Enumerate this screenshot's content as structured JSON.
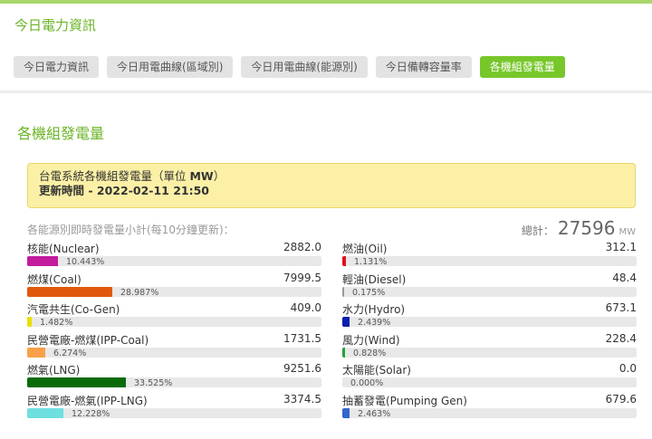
{
  "header": {
    "title": "今日電力資訊",
    "tabs": [
      {
        "label": "今日電力資訊",
        "active": false
      },
      {
        "label": "今日用電曲線(區域別)",
        "active": false
      },
      {
        "label": "今日用電曲線(能源別)",
        "active": false
      },
      {
        "label": "今日備轉容量率",
        "active": false
      },
      {
        "label": "各機組發電量",
        "active": true
      }
    ]
  },
  "section": {
    "title": "各機組發電量",
    "notice_line1_prefix": "台電系統各機組發電量（單位 ",
    "notice_unit": "MW",
    "notice_line1_suffix": "）",
    "notice_line2_prefix": "更新時間 - ",
    "notice_time": "2022-02-11 21:50",
    "subtitle": "各能源別即時發電量小計(每10分鐘更新)：",
    "total_label": "總計：",
    "total_value": "27596",
    "total_unit": "MW"
  },
  "colors": {
    "accent": "#77c72a",
    "title_green": "#6ab425",
    "notice_bg": "#fbf0a6"
  },
  "left_items": [
    {
      "name": "核能(Nuclear)",
      "value": "2882.0",
      "pct_label": "10.443%",
      "pct": 10.443,
      "color": "#c21b9e"
    },
    {
      "name": "燃煤(Coal)",
      "value": "7999.5",
      "pct_label": "28.987%",
      "pct": 28.987,
      "color": "#e0580c"
    },
    {
      "name": "汽電共生(Co-Gen)",
      "value": "409.0",
      "pct_label": "1.482%",
      "pct": 1.482,
      "color": "#e8e000"
    },
    {
      "name": "民營電廠-燃煤(IPP-Coal)",
      "value": "1731.5",
      "pct_label": "6.274%",
      "pct": 6.274,
      "color": "#f8a14a"
    },
    {
      "name": "燃氣(LNG)",
      "value": "9251.6",
      "pct_label": "33.525%",
      "pct": 33.525,
      "color": "#0b6b0b"
    },
    {
      "name": "民營電廠-燃氣(IPP-LNG)",
      "value": "3374.5",
      "pct_label": "12.228%",
      "pct": 12.228,
      "color": "#6fdfe0"
    }
  ],
  "right_items": [
    {
      "name": "燃油(Oil)",
      "value": "312.1",
      "pct_label": "1.131%",
      "pct": 1.131,
      "color": "#e0101c"
    },
    {
      "name": "輕油(Diesel)",
      "value": "48.4",
      "pct_label": "0.175%",
      "pct": 0.175,
      "color": "#999999"
    },
    {
      "name": "水力(Hydro)",
      "value": "673.1",
      "pct_label": "2.439%",
      "pct": 2.439,
      "color": "#0a1fb0"
    },
    {
      "name": "風力(Wind)",
      "value": "228.4",
      "pct_label": "0.828%",
      "pct": 0.828,
      "color": "#21a33a"
    },
    {
      "name": "太陽能(Solar)",
      "value": "0.0",
      "pct_label": "0.000%",
      "pct": 0.0,
      "color": "#f0c000"
    },
    {
      "name": "抽蓄發電(Pumping Gen)",
      "value": "679.6",
      "pct_label": "2.463%",
      "pct": 2.463,
      "color": "#3366cc"
    }
  ]
}
